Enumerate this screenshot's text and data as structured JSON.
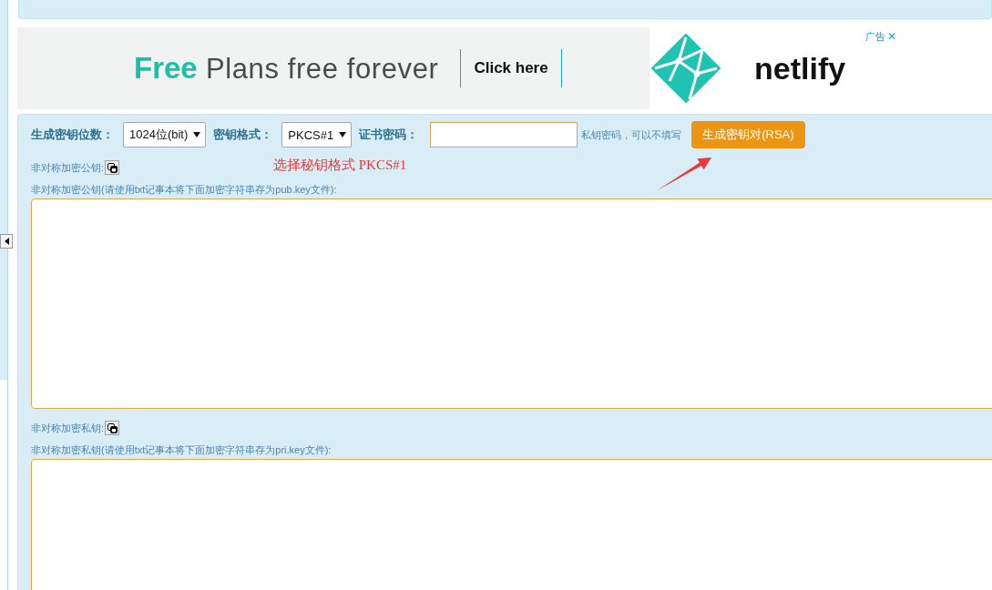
{
  "ad": {
    "headline": "**Free** Plans free forever",
    "cta": "Click here",
    "brand": "netlify",
    "label": "广告",
    "close": "✕"
  },
  "form": {
    "fields": [
      {
        "kind": "select",
        "label": "生成密钥位数：",
        "value": "1024位(bit)"
      },
      {
        "kind": "select",
        "label": "密钥格式：",
        "value": "PKCS#1"
      },
      {
        "kind": "input",
        "label": "证书密码：",
        "note": "私钥密码，可以不填写"
      }
    ],
    "generate_button": "生成密钥对(RSA)",
    "annotation": "选择秘钥格式 PKCS#1"
  },
  "keys": [
    {
      "label": "非对称加密公钥:",
      "caption": "非对称加密公钥(请使用txt记事本将下面加密字符串存为pub.key文件):"
    },
    {
      "label": "非对称加密私钥:",
      "caption": "非对称加密私钥(请使用txt记事本将下面加密字符串存为pri.key文件):"
    }
  ]
}
